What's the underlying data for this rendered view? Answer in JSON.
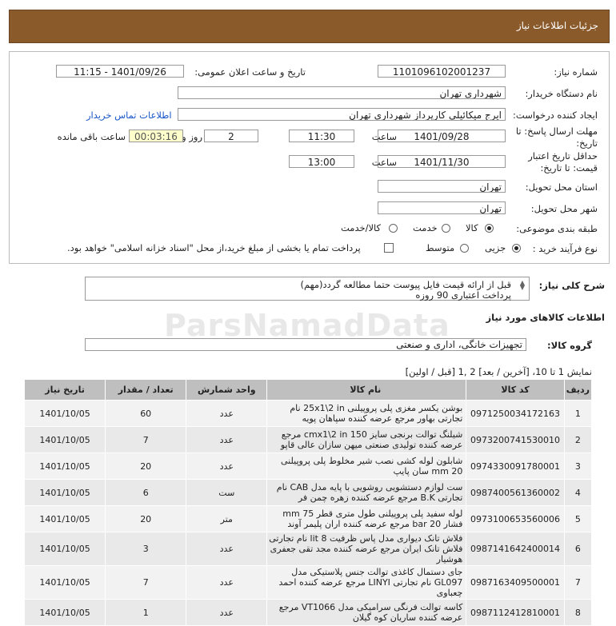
{
  "header": {
    "title": "جزئیات اطلاعات نیاز"
  },
  "form": {
    "need_number_label": "شماره نیاز:",
    "need_number": "1101096102001237",
    "announce_label": "تاریخ و ساعت اعلان عمومی:",
    "announce_value": "1401/09/26 - 11:15",
    "buyer_label": "نام دستگاه خریدار:",
    "buyer_value": "شهرداری تهران",
    "creator_label": "ایجاد کننده درخواست:",
    "creator_value": "ایرج میکائیلی کارپرداز شهرداری تهران",
    "contact_link": "اطلاعات تماس خریدار",
    "deadline_label_1": "مهلت ارسال پاسخ: تا",
    "deadline_label_2": "تاریخ:",
    "deadline_date": "1401/09/28",
    "time_label": "ساعت",
    "deadline_time": "11:30",
    "days_value": "2",
    "days_and_label": "روز و",
    "remaining_value": "00:03:16",
    "remaining_label": "ساعت باقی مانده",
    "validity_label_1": "حداقل تاریخ اعتبار",
    "validity_label_2": "قیمت: تا تاریخ:",
    "validity_date": "1401/11/30",
    "validity_time": "13:00",
    "province_label": "استان محل تحویل:",
    "province_value": "تهران",
    "city_label": "شهر محل تحویل:",
    "city_value": "تهران",
    "category_label": "طبقه بندی موضوعی:",
    "cat_opt_goods": "کالا",
    "cat_opt_service": "خدمت",
    "cat_opt_both": "کالا/خدمت",
    "process_label": "نوع فرآیند خرید :",
    "proc_opt_partial": "جزیی",
    "proc_opt_medium": "متوسط",
    "treasury_text": "پرداخت تمام یا بخشی از مبلغ خرید،از محل \"اسناد خزانه اسلامی\" خواهد بود."
  },
  "description": {
    "label": "شرح کلی نیاز:",
    "line1": "قبل از ارائه قیمت فایل پیوست حتما مطالعه گردد(مهم)",
    "line2": "پرداخت اعتباری  90 روزه"
  },
  "goods": {
    "section_title": "اطلاعات کالاهای مورد نیاز",
    "group_label": "گروه کالا:",
    "group_value": "تجهیزات خانگی، اداری و صنعتی",
    "pager": "نمایش 1 تا 10، [آخرین / بعد] 2 ,1 [قبل / اولین]"
  },
  "watermark": "ParsNamadData",
  "table": {
    "headers": [
      "ردیف",
      "کد کالا",
      "نام کالا",
      "واحد شمارش",
      "تعداد / مقدار",
      "تاریخ نیاز"
    ],
    "rows": [
      [
        "1",
        "0971250034172163",
        "بوشن یکسر مغزی پلی پروپیلنی 25x1\\2 in نام تجارتی بهاور مرجع عرضه کننده سپاهان پویه",
        "عدد",
        "60",
        "1401/10/05"
      ],
      [
        "2",
        "0973200741530010",
        "شیلنگ توالت برنجی سایز 150 cmx1\\2 in مرجع عرضه کننده تولیدی صنعتی میهن سازان عالی قاپو",
        "عدد",
        "7",
        "1401/10/05"
      ],
      [
        "3",
        "0974330091780001",
        "شابلون لوله کشی نصب شیر مخلوط پلی پروپیلنی 20 mm سان پایپ",
        "عدد",
        "20",
        "1401/10/05"
      ],
      [
        "4",
        "0987400561360002",
        "ست لوازم دستشویی روشویی با پایه مدل CAB نام تجارتی B.K مرجع عرضه کننده زهره چمن فر",
        "ست",
        "6",
        "1401/10/05"
      ],
      [
        "5",
        "0973100653560006",
        "لوله سفید پلی پروپیلنی طول متری قطر 75 mm فشار 20 bar مرجع عرضه کننده اران پلیمر آوند",
        "متر",
        "20",
        "1401/10/05"
      ],
      [
        "6",
        "0987141642400014",
        "فلاش تانک دیواری مدل پاس ظرفیت 8 lit نام تجارتی فلاش تانک ایران مرجع عرضه کننده مجد تقی جعفری هوشیار",
        "عدد",
        "3",
        "1401/10/05"
      ],
      [
        "7",
        "0987163409500001",
        "جای دستمال کاغذی توالت جنس پلاستیکی مدل GL097 نام تجارتی LINYI مرجع عرضه کننده احمد چعباوی",
        "عدد",
        "7",
        "1401/10/05"
      ],
      [
        "8",
        "0987112412810001",
        "کاسه توالت فرنگی سرامیکی مدل VT1066 مرجع عرضه کننده ساریان کوه گیلان",
        "عدد",
        "1",
        "1401/10/05"
      ]
    ]
  }
}
